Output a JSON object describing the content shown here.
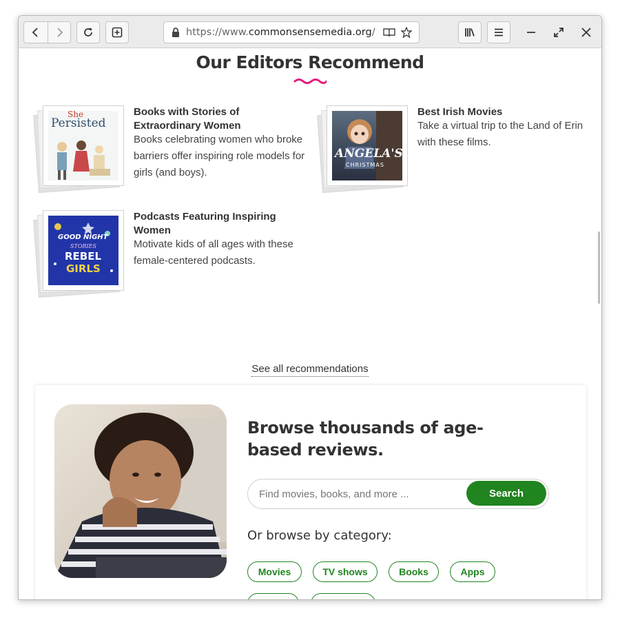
{
  "browser": {
    "url_prefix": "https://www.",
    "url_domain": "commonsensemedia.org",
    "url_suffix": "/",
    "icons": {
      "back": "arrow-left-icon",
      "forward": "arrow-right-icon",
      "reload": "reload-icon",
      "new_tab": "plus-square-icon",
      "lock": "lock-icon",
      "reader": "reader-view-icon",
      "bookmark": "star-icon",
      "library": "library-icon",
      "menu": "hamburger-icon",
      "minimize": "minimize-icon",
      "maximize": "maximize-icon",
      "close": "close-icon"
    }
  },
  "recommend": {
    "title": "Our Editors Recommend",
    "items": [
      {
        "title": "Books with Stories of Extraordinary Women",
        "description": "Books celebrating women who broke barriers offer inspiring role models for girls (and boys).",
        "cover_text_1": "She",
        "cover_text_2": "Persisted"
      },
      {
        "title": "Best Irish Movies",
        "description": "Take a virtual trip to the Land of Erin with these films.",
        "cover_text_1": "ANGELA'S",
        "cover_text_2": "CHRISTMAS"
      },
      {
        "title": "Podcasts Featuring Inspiring Women",
        "description": "Motivate kids of all ages with these female-centered podcasts.",
        "cover_text_1": "GOOD NIGHT",
        "cover_text_2": "STORIES",
        "cover_text_3": "REBEL",
        "cover_text_4": "GIRLS"
      }
    ],
    "see_all": "See all recommendations"
  },
  "browse": {
    "title": "Browse thousands of age-based reviews.",
    "search_placeholder": "Find movies, books, and more ...",
    "search_button": "Search",
    "subtitle": "Or browse by category:",
    "categories": [
      "Movies",
      "TV shows",
      "Books",
      "Apps"
    ]
  },
  "colors": {
    "accent_green": "#20841f",
    "squiggle_pink": "#e5197a"
  }
}
